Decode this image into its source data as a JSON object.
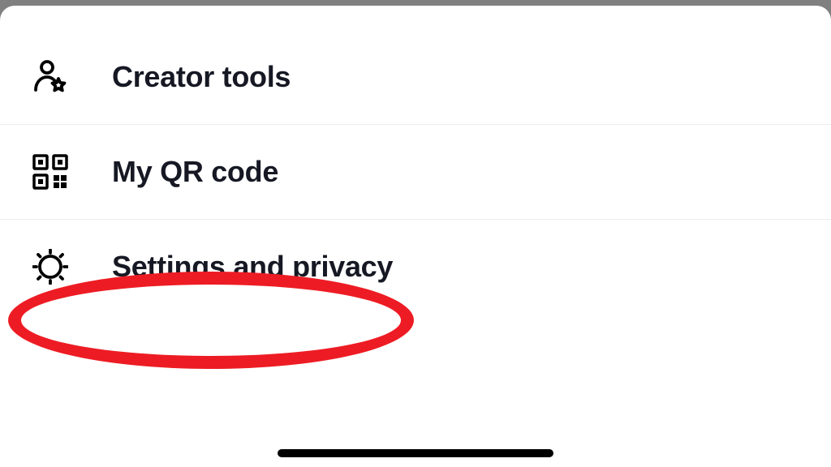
{
  "menu": {
    "items": [
      {
        "label": "Creator tools",
        "icon": "person-star-icon"
      },
      {
        "label": "My QR code",
        "icon": "qr-code-icon"
      },
      {
        "label": "Settings and privacy",
        "icon": "gear-icon"
      }
    ]
  },
  "highlight": {
    "color": "#ed1c24"
  }
}
